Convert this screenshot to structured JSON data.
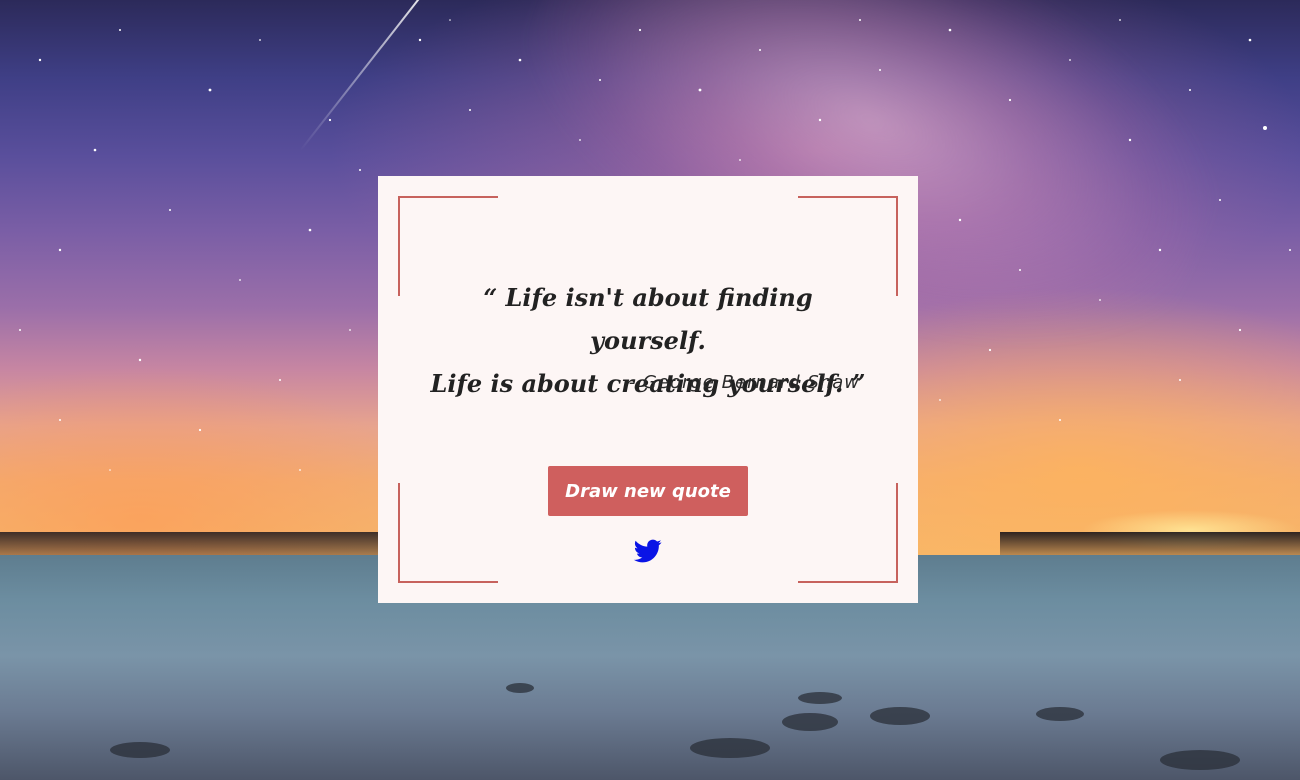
{
  "quote": {
    "text_line1": "“ Life isn't about finding yourself.",
    "text_line2": "Life is about creating yourself. ”",
    "author": "- George Bernard Shaw"
  },
  "actions": {
    "new_quote_label": "Draw new quote",
    "tweet_icon": "twitter-bird-icon"
  },
  "colors": {
    "card_background": "#fdf6f5",
    "accent": "#cf5f5e",
    "frame": "#c7625d",
    "tweet_icon": "#0a14e6"
  }
}
